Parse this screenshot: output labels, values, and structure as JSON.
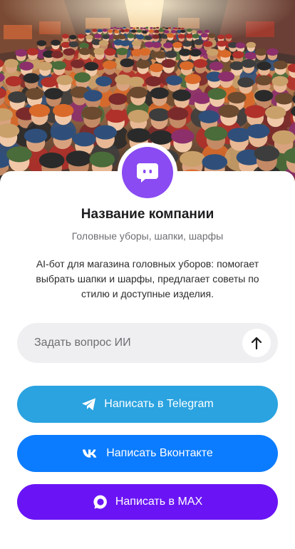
{
  "company": {
    "name": "Название компании",
    "tagline": "Головные уборы, шапки, шарфы",
    "description": "AI-бот для магазина головных уборов: помогает выбрать шапки и шарфы, предлагает советы по стилю и доступные изделия."
  },
  "ask": {
    "placeholder": "Задать вопрос ИИ"
  },
  "buttons": {
    "telegram": {
      "label": "Написать в Telegram",
      "icon": "telegram-icon",
      "color": "#2aa3e0"
    },
    "vk": {
      "label": "Написать Вконтакте",
      "icon": "vk-icon",
      "color": "#0b7cff"
    },
    "max": {
      "label": "Написать в MAX",
      "icon": "max-icon",
      "color": "#6a14f5"
    }
  },
  "colors": {
    "avatar": "#8a4bf2",
    "ask_background": "#efeff1"
  }
}
